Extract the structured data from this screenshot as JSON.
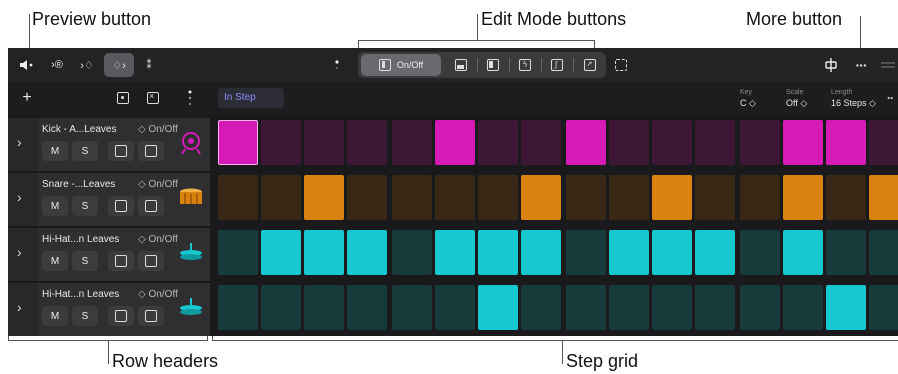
{
  "callouts": {
    "preview_button": "Preview button",
    "edit_mode_buttons": "Edit Mode buttons",
    "more_button": "More button",
    "row_headers": "Row headers",
    "step_grid": "Step grid"
  },
  "toolbar": {
    "edit_modes": [
      {
        "label": "On/Off",
        "icon": "on-off-mode-icon",
        "selected": true
      },
      {
        "label": "",
        "icon": "velocity-mode-icon"
      },
      {
        "label": "",
        "icon": "note-repeat-mode-icon"
      },
      {
        "label": "",
        "icon": "chance-mode-icon"
      },
      {
        "label": "",
        "icon": "offset-mode-icon"
      },
      {
        "label": "",
        "icon": "transpose-mode-icon"
      }
    ]
  },
  "subbar": {
    "pattern_label": "In Step",
    "key": {
      "label": "Key",
      "value": "C ◇"
    },
    "scale": {
      "label": "Scale",
      "value": "Off ◇"
    },
    "length": {
      "label": "Length",
      "value": "16 Steps ◇"
    }
  },
  "rows": [
    {
      "name": "Kick - A...Leaves",
      "mode": "◇ On/Off",
      "mute": "M",
      "solo": "S",
      "instrument": "kick-drum-icon",
      "color": "#d61ab6",
      "steps": [
        1,
        0,
        0,
        0,
        0,
        1,
        0,
        0,
        1,
        0,
        0,
        0,
        0,
        1,
        1,
        0
      ]
    },
    {
      "name": "Snare -...Leaves",
      "mode": "◇ On/Off",
      "mute": "M",
      "solo": "S",
      "instrument": "snare-drum-icon",
      "color": "#d9820f",
      "steps": [
        0,
        0,
        1,
        0,
        0,
        0,
        0,
        1,
        0,
        0,
        1,
        0,
        0,
        1,
        0,
        1
      ]
    },
    {
      "name": "Hi-Hat...n Leaves",
      "mode": "◇ On/Off",
      "mute": "M",
      "solo": "S",
      "instrument": "hi-hat-icon",
      "color": "#16c8d0",
      "steps": [
        0,
        1,
        1,
        1,
        0,
        1,
        1,
        1,
        0,
        1,
        1,
        1,
        0,
        1,
        0,
        0
      ]
    },
    {
      "name": "Hi-Hat...n Leaves",
      "mode": "◇ On/Off",
      "mute": "M",
      "solo": "S",
      "instrument": "hi-hat-icon",
      "color": "#16c8d0",
      "steps": [
        0,
        0,
        0,
        0,
        0,
        0,
        1,
        0,
        0,
        0,
        0,
        0,
        0,
        0,
        1,
        0
      ]
    }
  ],
  "colors": {
    "pink_on": "#d61ab6",
    "pink_off": "#3e1636",
    "orange_on": "#d9820f",
    "orange_off": "#3a2816",
    "cyan_on": "#16c8d0",
    "cyan_off": "#173a3a",
    "pattern_text": "#8a8aff"
  }
}
